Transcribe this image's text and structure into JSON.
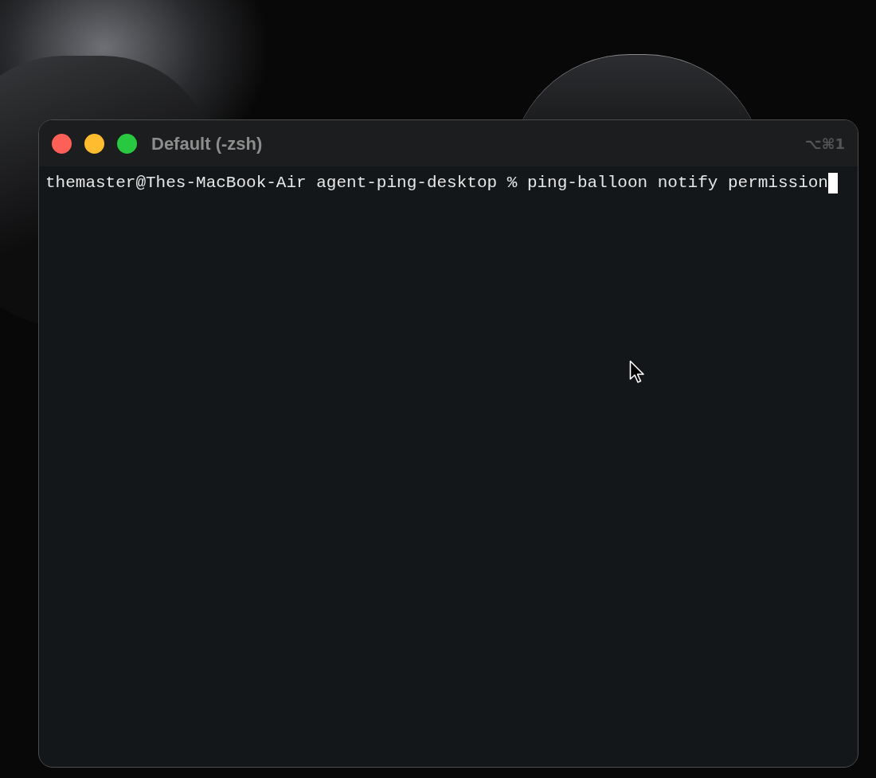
{
  "window": {
    "title": "Default (-zsh)",
    "shortcut": "⌥⌘1"
  },
  "terminal": {
    "lines": [
      {
        "text": "themaster@Thes-MacBook-Air agent-ping-desktop % ping-balloon notify permission",
        "cursor": true
      }
    ]
  }
}
